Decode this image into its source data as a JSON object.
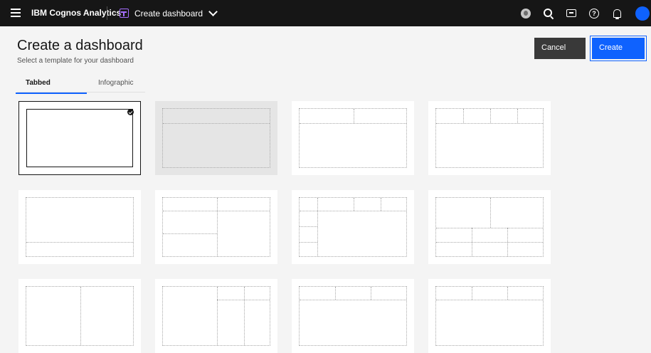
{
  "topbar": {
    "brand": "IBM Cognos Analytics",
    "context_label": "Create dashboard",
    "icons": [
      "globe-icon",
      "search-icon",
      "chat-icon",
      "help-icon",
      "notification-icon",
      "user-avatar-icon"
    ]
  },
  "header": {
    "title": "Create a dashboard",
    "subtitle": "Select a template for your dashboard"
  },
  "actions": {
    "cancel_label": "Cancel",
    "create_label": "Create"
  },
  "tabs": [
    {
      "label": "Tabbed",
      "selected": true
    },
    {
      "label": "Infographic",
      "selected": false
    }
  ],
  "templates": {
    "selected_index": 0,
    "hovered_index": 1,
    "count_visible": 12
  },
  "colors": {
    "topbar": "#161616",
    "primary": "#0f62fe",
    "secondary": "#393939",
    "background": "#f4f4f4",
    "accent_icon": "#a56eff"
  }
}
